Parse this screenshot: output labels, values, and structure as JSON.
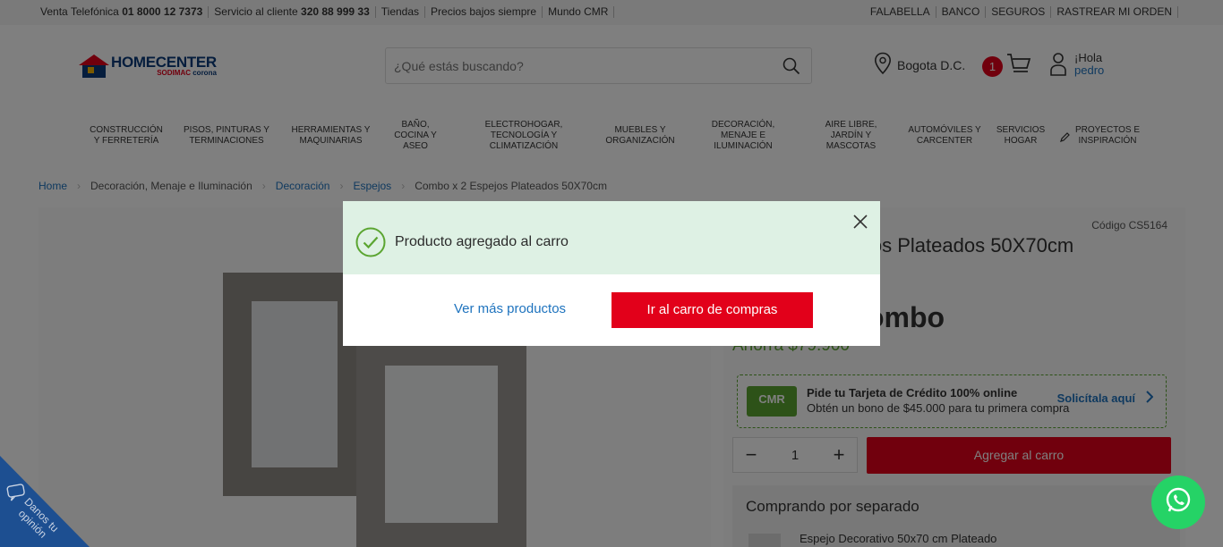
{
  "topbar": {
    "venta_label": "Venta Telefónica",
    "venta_number": "01 8000 12 7373",
    "servicio_label": "Servicio al cliente",
    "servicio_number": "320 88 999 33",
    "tiendas": "Tiendas",
    "precios": "Precios bajos siempre",
    "mundo": "Mundo CMR",
    "falabella": "FALABELLA",
    "banco": "BANCO",
    "seguros": "SEGUROS",
    "rastrear": "RASTREAR MI ORDEN"
  },
  "header": {
    "logo_brand": "HOMECENTER",
    "logo_sub1": "SODIMAC",
    "logo_sub2": "corona",
    "search_placeholder": "¿Qué estás buscando?",
    "location": "Bogota D.C.",
    "cart_count": "1",
    "greeting": "¡Hola",
    "user_name": "pedro"
  },
  "nav": {
    "items": [
      "CONSTRUCCIÓN Y FERRETERÍA",
      "PISOS, PINTURAS Y TERMINACIONES",
      "HERRAMIENTAS Y MAQUINARIAS",
      "BAÑO, COCINA Y ASEO",
      "ELECTROHOGAR, TECNOLOGÍA Y CLIMATIZACIÓN",
      "MUEBLES Y ORGANIZACIÓN",
      "DECORACIÓN, MENAJE E ILUMINACIÓN",
      "AIRE LIBRE, JARDÍN Y MASCOTAS",
      "AUTOMÓVILES Y CARCENTER",
      "SERVICIOS HOGAR",
      "PROYECTOS E INSPIRACIÓN"
    ]
  },
  "breadcrumb": [
    "Home",
    "Decoración, Menaje e Iluminación",
    "Decoración",
    "Espejos",
    "Combo x 2 Espejos Plateados 50X70cm"
  ],
  "product": {
    "code": "Código CS5164",
    "title": "jos Plateados 50X70cm",
    "combo": "ombo",
    "sale": "Ahorra $79.900",
    "cmr_card": "CMR",
    "cmr_title": "Pide tu Tarjeta de Crédito 100% online",
    "cmr_sub": "Obtén un bono de $45.000 para tu primera compra",
    "cmr_link": "Solicítala aquí",
    "qty": "1",
    "minus": "−",
    "plus": "+",
    "add_to_cart": "Agregar al carro",
    "separado_heading": "Comprando por separado",
    "separado_item": "Espejo Decorativo 50x70 cm Plateado"
  },
  "feedback": {
    "label": "Danos tu opinión"
  },
  "modal": {
    "message": "Producto agregado al carro",
    "more": "Ver más productos",
    "go_cart": "Ir al carro de compras"
  },
  "colors": {
    "brand_red": "#e2001a",
    "brand_blue": "#0a3b7a",
    "link_blue": "#1e73be",
    "success_bg": "#def1e4",
    "success_green": "#5ba531",
    "whatsapp": "#25d366"
  }
}
